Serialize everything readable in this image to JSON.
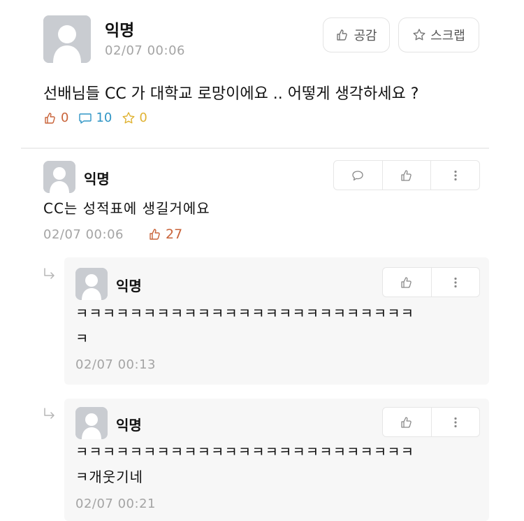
{
  "post": {
    "author": "익명",
    "time": "02/07 00:06",
    "like_button": "공감",
    "scrap_button": "스크랩",
    "body": "선배님들 CC 가 대학교 로망이에요 .. 어떻게 생각하세요 ?",
    "votes": "0",
    "comments": "10",
    "scraps": "0"
  },
  "comment": {
    "author": "익명",
    "text": "CC는 성적표에 생길거에요",
    "time": "02/07 00:06",
    "votes": "27"
  },
  "replies": [
    {
      "author": "익명",
      "line1": "ㅋㅋㅋㅋㅋㅋㅋㅋㅋㅋㅋㅋㅋㅋㅋㅋㅋㅋㅋㅋㅋㅋㅋㅋㅋ",
      "line2": "ㅋ",
      "time": "02/07 00:13"
    },
    {
      "author": "익명",
      "line1": "ㅋㅋㅋㅋㅋㅋㅋㅋㅋㅋㅋㅋㅋㅋㅋㅋㅋㅋㅋㅋㅋㅋㅋㅋㅋ",
      "line2": "ㅋ개웃기네",
      "time": "02/07 00:21"
    }
  ],
  "colors": {
    "vote": "#c9643a",
    "comment": "#2f95c5",
    "scrap": "#e0b334",
    "meta": "#a4a4a4"
  },
  "icons": [
    "thumbs-up-icon",
    "star-icon",
    "speech-bubble-icon",
    "more-icon",
    "reply-arrow-icon",
    "avatar-icon"
  ]
}
